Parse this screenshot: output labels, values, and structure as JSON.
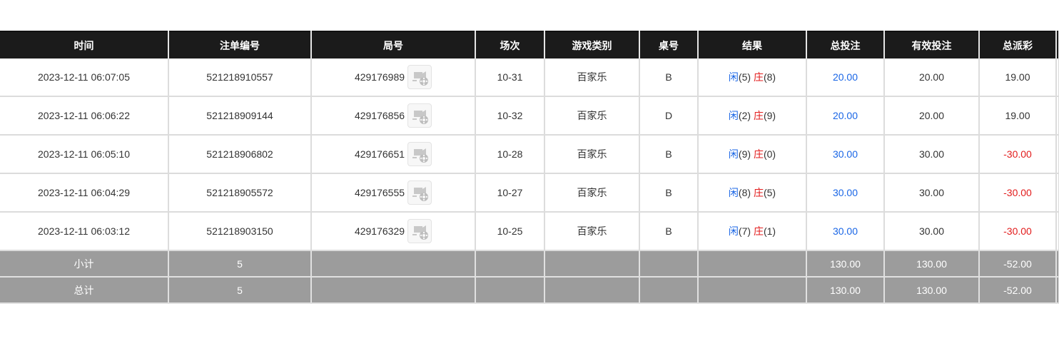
{
  "columns": [
    "时间",
    "注单编号",
    "局号",
    "场次",
    "游戏类别",
    "桌号",
    "结果",
    "总投注",
    "有效投注",
    "总派彩"
  ],
  "rows": [
    {
      "time": "2023-12-11 06:07:05",
      "bet_id": "521218910557",
      "round_id": "429176989",
      "session": "10-31",
      "game": "百家乐",
      "table": "B",
      "result": {
        "player_label": "闲",
        "player_score": "(5)",
        "banker_label": "庄",
        "banker_score": "(8)"
      },
      "total_bet": "20.00",
      "valid_bet": "20.00",
      "payout": "19.00"
    },
    {
      "time": "2023-12-11 06:06:22",
      "bet_id": "521218909144",
      "round_id": "429176856",
      "session": "10-32",
      "game": "百家乐",
      "table": "D",
      "result": {
        "player_label": "闲",
        "player_score": "(2)",
        "banker_label": "庄",
        "banker_score": "(9)"
      },
      "total_bet": "20.00",
      "valid_bet": "20.00",
      "payout": "19.00"
    },
    {
      "time": "2023-12-11 06:05:10",
      "bet_id": "521218906802",
      "round_id": "429176651",
      "session": "10-28",
      "game": "百家乐",
      "table": "B",
      "result": {
        "player_label": "闲",
        "player_score": "(9)",
        "banker_label": "庄",
        "banker_score": "(0)"
      },
      "total_bet": "30.00",
      "valid_bet": "30.00",
      "payout": "-30.00"
    },
    {
      "time": "2023-12-11 06:04:29",
      "bet_id": "521218905572",
      "round_id": "429176555",
      "session": "10-27",
      "game": "百家乐",
      "table": "B",
      "result": {
        "player_label": "闲",
        "player_score": "(8)",
        "banker_label": "庄",
        "banker_score": "(5)"
      },
      "total_bet": "30.00",
      "valid_bet": "30.00",
      "payout": "-30.00"
    },
    {
      "time": "2023-12-11 06:03:12",
      "bet_id": "521218903150",
      "round_id": "429176329",
      "session": "10-25",
      "game": "百家乐",
      "table": "B",
      "result": {
        "player_label": "闲",
        "player_score": "(7)",
        "banker_label": "庄",
        "banker_score": "(1)"
      },
      "total_bet": "30.00",
      "valid_bet": "30.00",
      "payout": "-30.00"
    }
  ],
  "subtotal": {
    "label": "小计",
    "count": "5",
    "total_bet": "130.00",
    "valid_bet": "130.00",
    "payout": "-52.00"
  },
  "grand_total": {
    "label": "总计",
    "count": "5",
    "total_bet": "130.00",
    "valid_bet": "130.00",
    "payout": "-52.00"
  },
  "icons": {
    "replay": "replay-video-icon"
  },
  "colors": {
    "header_bg": "#1b1b1b",
    "total_bg": "#9c9c9c",
    "blue": "#1a66e6",
    "red": "#e21b1b"
  }
}
